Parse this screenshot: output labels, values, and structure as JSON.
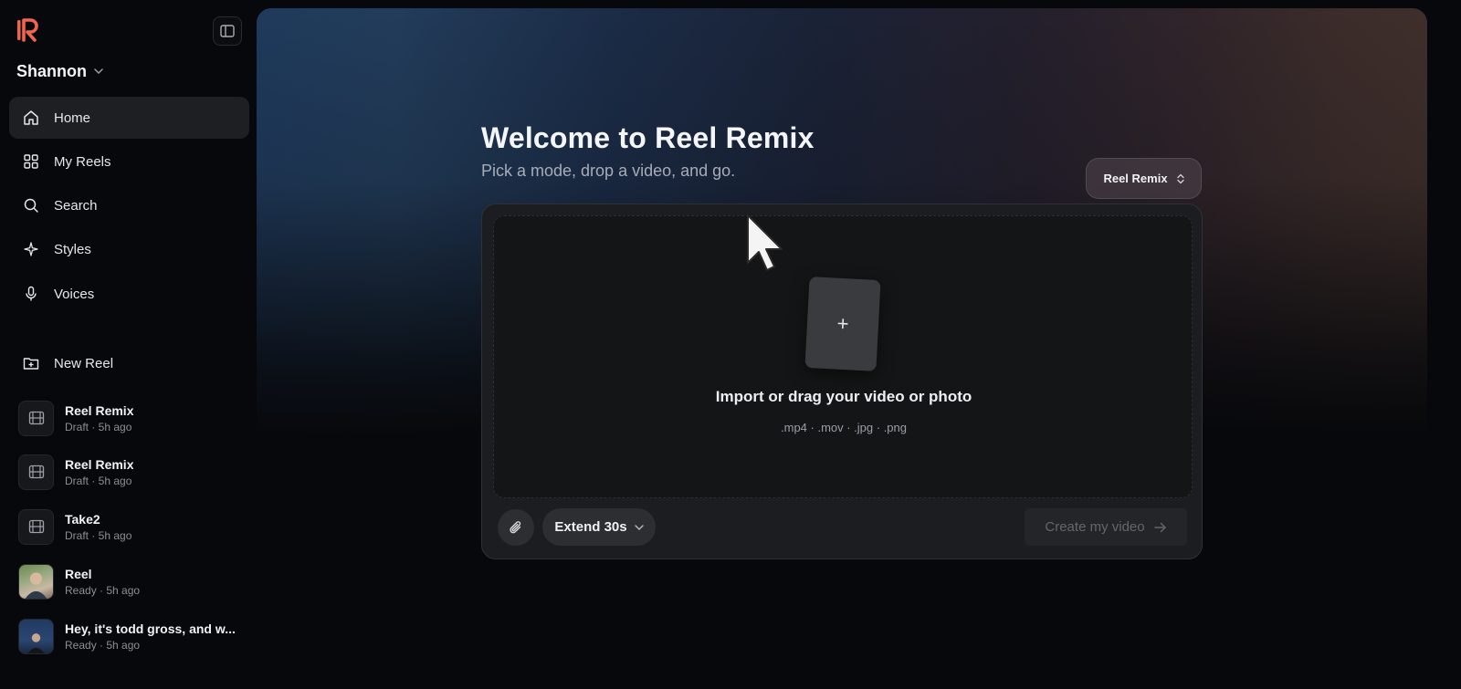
{
  "sidebar": {
    "workspace_name": "Shannon",
    "nav": [
      {
        "label": "Home",
        "icon": "home-icon",
        "active": true
      },
      {
        "label": "My Reels",
        "icon": "grid-icon"
      },
      {
        "label": "Search",
        "icon": "search-icon"
      },
      {
        "label": "Styles",
        "icon": "sparkle-icon"
      },
      {
        "label": "Voices",
        "icon": "microphone-icon"
      }
    ],
    "new_reel_label": "New Reel",
    "reels": [
      {
        "title": "Reel Remix",
        "status": "Draft · 5h ago",
        "thumb": "film-icon"
      },
      {
        "title": "Reel Remix",
        "status": "Draft · 5h ago",
        "thumb": "film-icon"
      },
      {
        "title": "Take2",
        "status": "Draft · 5h ago",
        "thumb": "film-icon"
      },
      {
        "title": "Reel",
        "status": "Ready · 5h ago",
        "thumb": "photo-thumbnail"
      },
      {
        "title": "Hey, it's todd gross, and w...",
        "status": "Ready · 5h ago",
        "thumb": "photo-thumbnail"
      }
    ]
  },
  "main": {
    "title": "Welcome to Reel Remix",
    "subtitle": "Pick a mode, drop a video, and go.",
    "mode_selector": "Reel Remix",
    "dropzone": {
      "title": "Import or drag your video or photo",
      "formats": ".mp4 · .mov · .jpg · .png",
      "plus": "+"
    },
    "extend_label": "Extend 30s",
    "create_label": "Create my video"
  },
  "colors": {
    "accent_logo": "#f0654c",
    "background": "#07080b",
    "active_nav": "#1d1f23",
    "composer": "#1c1d20"
  }
}
